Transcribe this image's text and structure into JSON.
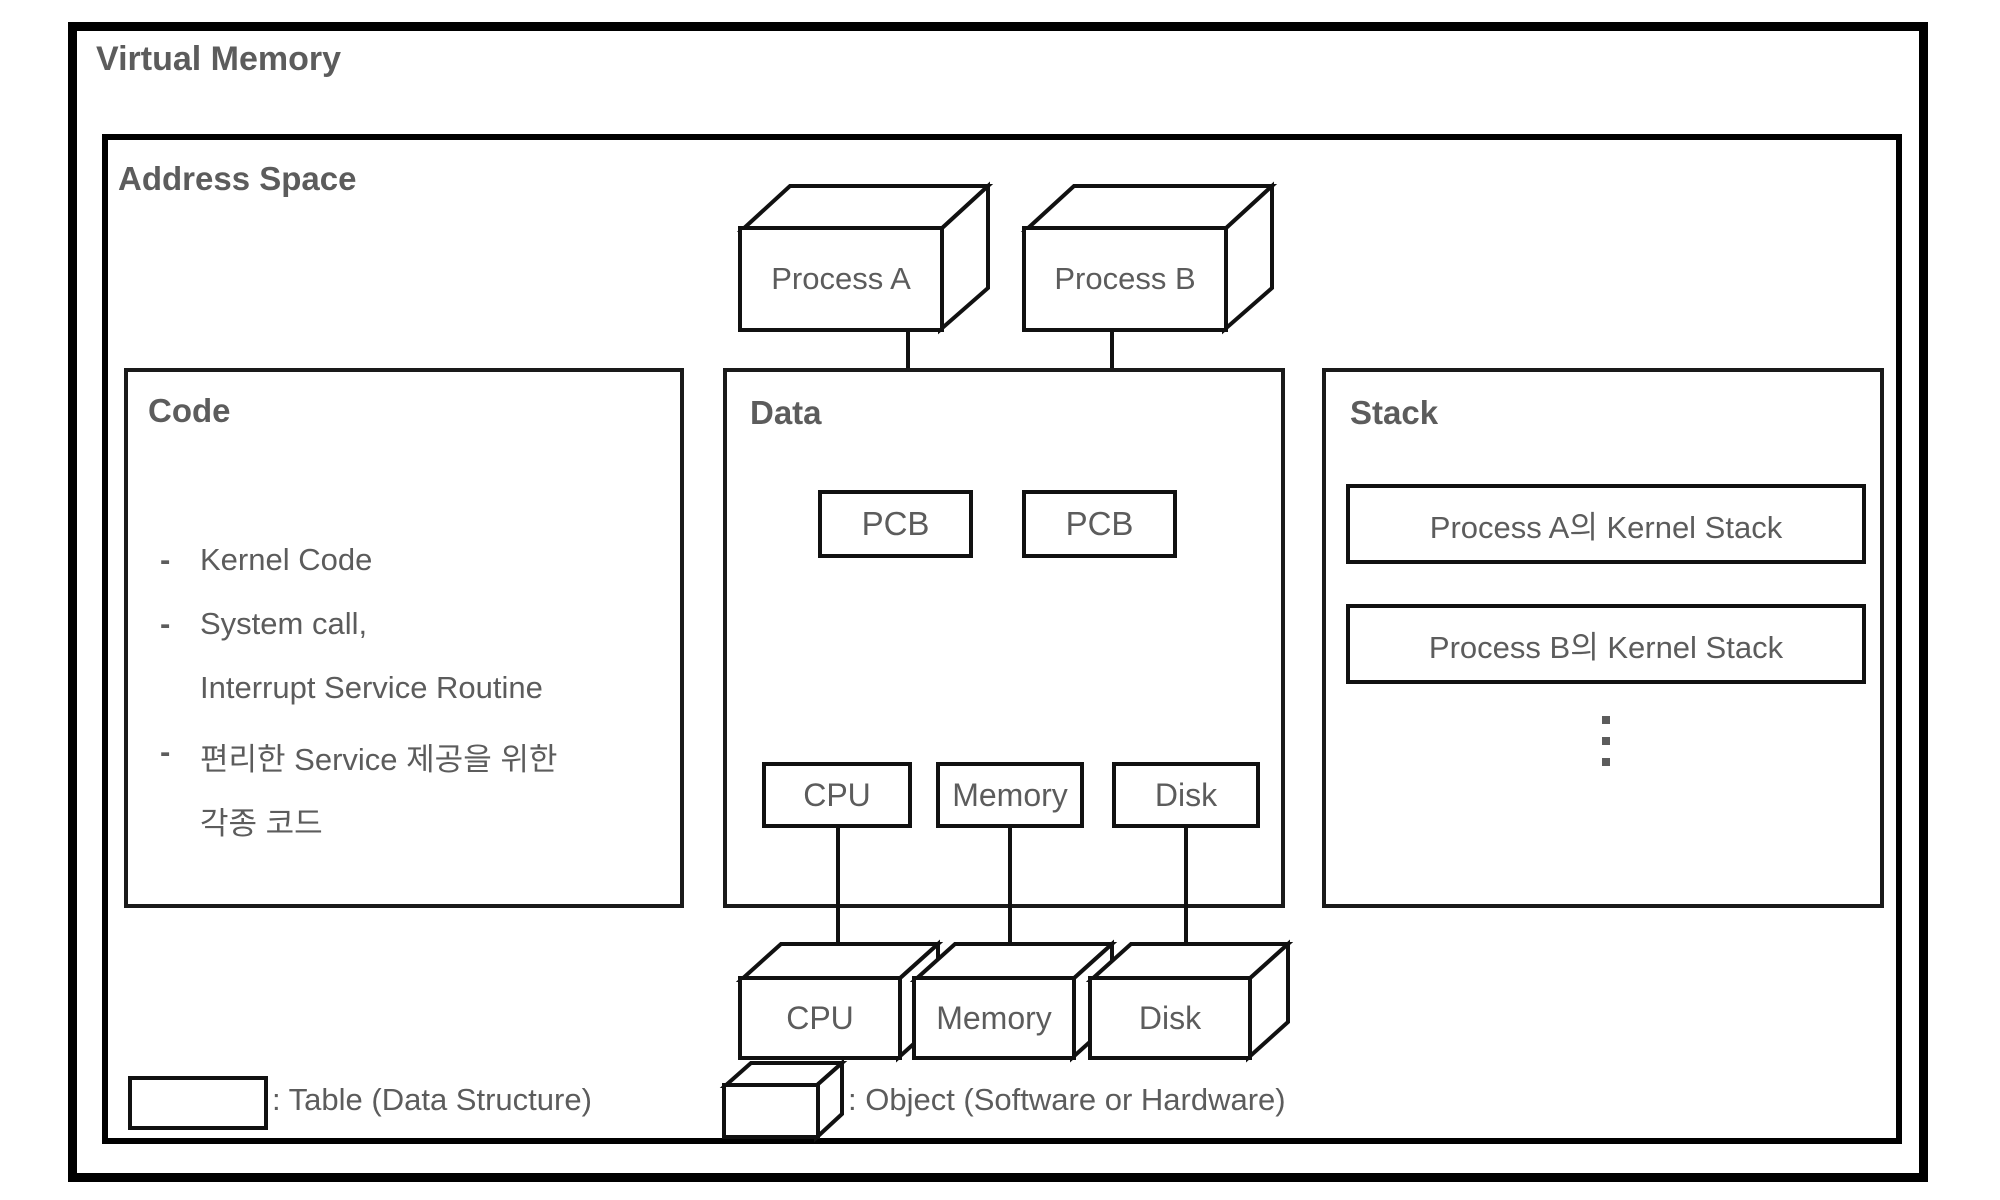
{
  "diagram": {
    "outer_title": "Virtual Memory",
    "inner_title": "Address Space",
    "accent_text_color": "#5c5c5c",
    "line_color": "#111111"
  },
  "processes": [
    {
      "label": "Process A"
    },
    {
      "label": "Process B"
    }
  ],
  "code_section": {
    "title": "Code",
    "bullets": [
      {
        "marker": "-",
        "lines": [
          "Kernel Code"
        ]
      },
      {
        "marker": "-",
        "lines": [
          "System call,",
          "Interrupt Service Routine"
        ]
      },
      {
        "marker": "-",
        "lines": [
          "편리한 Service 제공을 위한",
          "각종 코드"
        ]
      }
    ]
  },
  "data_section": {
    "title": "Data",
    "pcb_tables": [
      {
        "label": "PCB"
      },
      {
        "label": "PCB"
      }
    ],
    "resource_tables": [
      {
        "label": "CPU"
      },
      {
        "label": "Memory"
      },
      {
        "label": "Disk"
      }
    ]
  },
  "stack_section": {
    "title": "Stack",
    "entries": [
      {
        "label": "Process A의 Kernel Stack"
      },
      {
        "label": "Process B의 Kernel Stack"
      }
    ],
    "ellipsis": "vertical-ellipsis"
  },
  "hardware_objects": [
    {
      "label": "CPU"
    },
    {
      "label": "Memory"
    },
    {
      "label": "Disk"
    }
  ],
  "legend": [
    {
      "icon": "rectangle-outline-icon",
      "text": ": Table (Data Structure)"
    },
    {
      "icon": "cube-3d-icon",
      "text": ": Object (Software or Hardware)"
    }
  ]
}
